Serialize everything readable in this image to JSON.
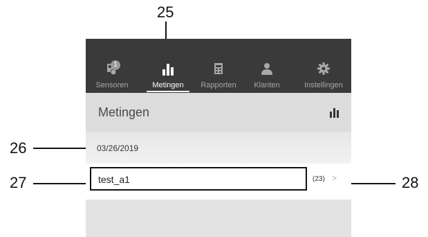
{
  "callouts": {
    "c25": "25",
    "c26": "26",
    "c27": "27",
    "c28": "28"
  },
  "nav": {
    "items": [
      {
        "label": "Sensoren",
        "icon": "sensor-icon",
        "badge": "1"
      },
      {
        "label": "Metingen",
        "icon": "bar-chart-icon"
      },
      {
        "label": "Rapporten",
        "icon": "report-icon"
      },
      {
        "label": "Klanten",
        "icon": "users-icon"
      },
      {
        "label": "Instellingen",
        "icon": "gear-icon"
      }
    ],
    "active": "Metingen"
  },
  "header": {
    "title": "Metingen",
    "action_icon": "bar-chart-icon"
  },
  "measurements": {
    "date": "03/26/2019",
    "items": [
      {
        "label": "test_a1",
        "count": "(23)"
      }
    ]
  },
  "colors": {
    "navbar_bg": "#3a3a3a",
    "nav_inactive": "#a8a8a8",
    "nav_active": "#ffffff",
    "content_bg": "#e5e5e5"
  }
}
